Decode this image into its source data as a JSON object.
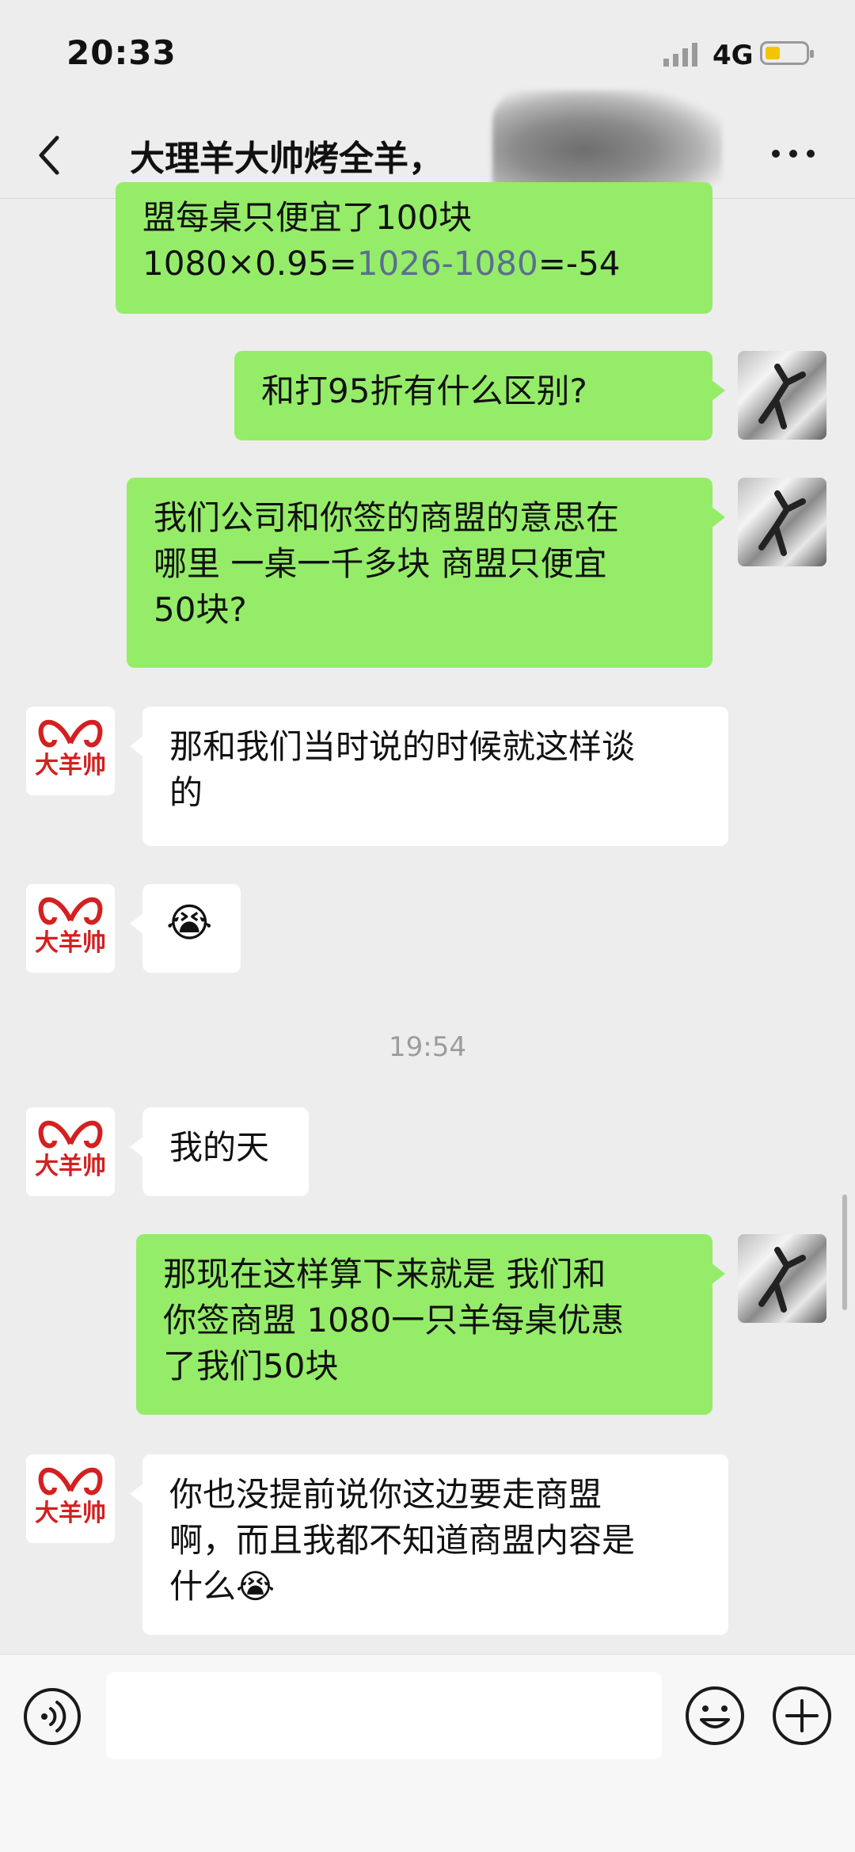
{
  "status_bar": {
    "time": "20:33",
    "network": "4G",
    "battery_level": 0.35
  },
  "header": {
    "title": "大理羊大帅烤全羊，"
  },
  "avatar_logo_text": "大羊帅",
  "messages": [
    {
      "id": "m0",
      "side": "left",
      "lines": [
        "盟每桌只便宜了100块"
      ],
      "calc_pre": "1080×0.95=",
      "calc_link": "1026-1080",
      "calc_post": "=-54"
    },
    {
      "id": "m1",
      "side": "right",
      "text": "和打95折有什么区别?"
    },
    {
      "id": "m2",
      "side": "right",
      "lines": [
        "我们公司和你签的商盟的意思在",
        "哪里  一桌一千多块  商盟只便宜",
        "50块?"
      ]
    },
    {
      "id": "m3",
      "side": "left",
      "lines": [
        "那和我们当时说的时候就这样谈",
        "的"
      ]
    },
    {
      "id": "m4",
      "side": "left",
      "emoji": "😭"
    },
    {
      "id": "m5",
      "side": "left",
      "text": "我的天"
    },
    {
      "id": "m6",
      "side": "right",
      "lines": [
        "那现在这样算下来就是   我们和",
        "你签商盟 1080一只羊每桌优惠",
        "了我们50块"
      ]
    },
    {
      "id": "m7",
      "side": "left",
      "lines": [
        "你也没提前说你这边要走商盟",
        "啊，而且我都不知道商盟内容是",
        "什么"
      ],
      "emoji": "😭"
    }
  ],
  "timestamp": "19:54",
  "colors": {
    "green_bubble": "#95ec69",
    "white_bubble": "#ffffff",
    "logo_red": "#d42020",
    "background": "#ededed"
  },
  "icons": [
    "back-arrow-icon",
    "more-icon",
    "voice-icon",
    "emoji-icon",
    "plus-icon"
  ]
}
